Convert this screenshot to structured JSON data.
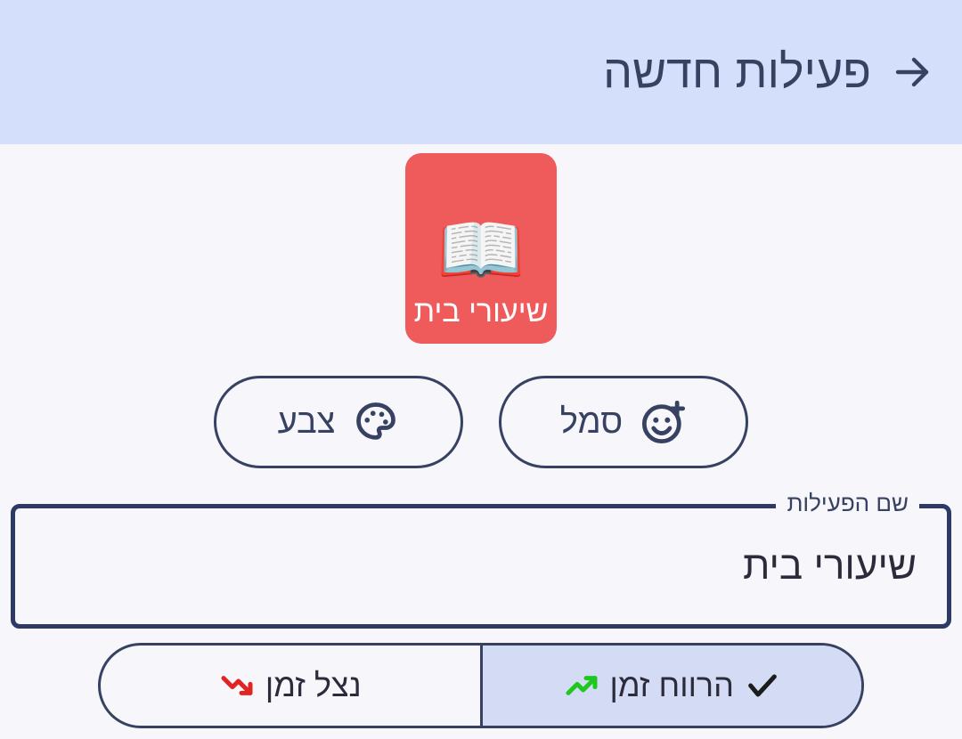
{
  "header": {
    "title": "פעילות חדשה"
  },
  "card": {
    "emoji": "📖",
    "label": "שיעורי בית"
  },
  "chips": {
    "symbol_label": "סמל",
    "color_label": "צבע"
  },
  "field": {
    "label": "שם הפעילות",
    "value": "שיעורי בית"
  },
  "segment": {
    "gain_label": "הרווח זמן",
    "spend_label": "נצל זמן",
    "selected": "gain"
  },
  "colors": {
    "header_bg": "#d4e0fb",
    "card_bg": "#ef5a5a",
    "border": "#374161",
    "seg_selected": "#d4dcf5",
    "trend_up": "#1ec81e",
    "trend_down": "#e02424"
  }
}
